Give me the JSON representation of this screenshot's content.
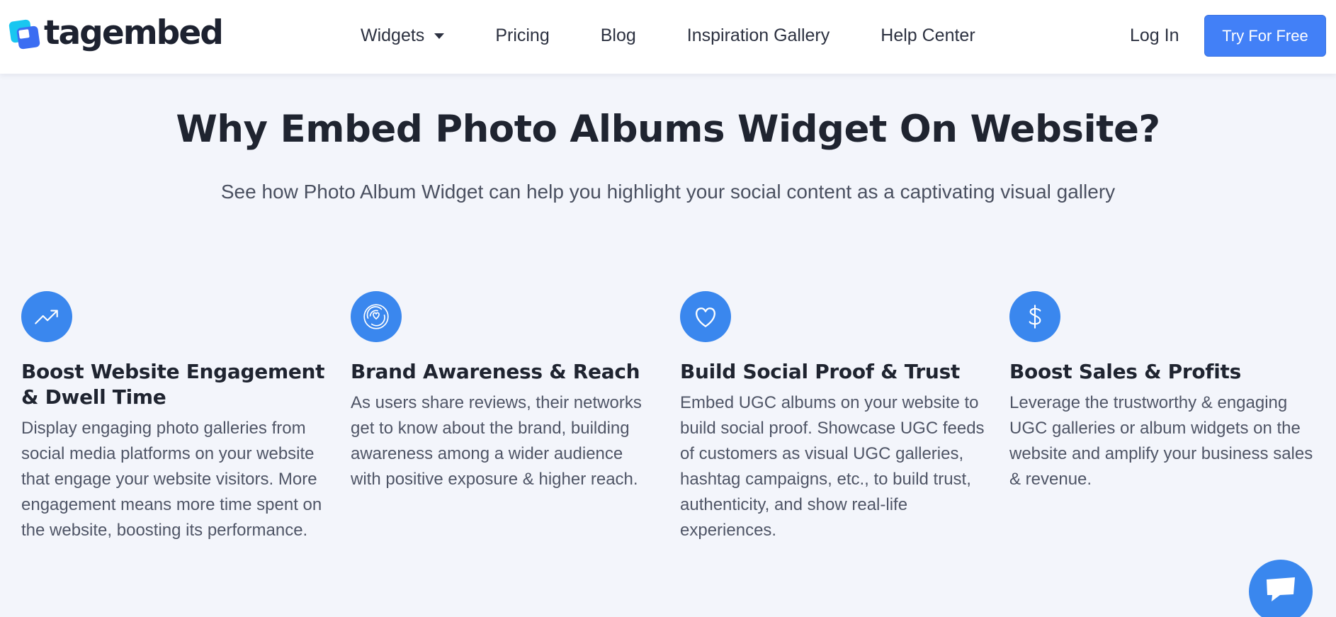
{
  "brand": {
    "name": "tagembed"
  },
  "nav": {
    "items": [
      {
        "label": "Widgets",
        "has_dropdown": true
      },
      {
        "label": "Pricing"
      },
      {
        "label": "Blog"
      },
      {
        "label": "Inspiration Gallery"
      },
      {
        "label": "Help Center"
      }
    ],
    "login_label": "Log In",
    "cta_label": "Try For Free"
  },
  "hero": {
    "title": "Why Embed Photo Albums Widget On Website?",
    "subtitle": "See how Photo Album Widget can help you highlight your social content as a captivating visual gallery"
  },
  "features": [
    {
      "icon": "trending-up-icon",
      "title": "Boost Website Engagement & Dwell Time",
      "text": "Display engaging photo galleries from social media platforms on your website that engage your website visitors. More engagement means more time spent on the website, boosting its performance."
    },
    {
      "icon": "heart-target-icon",
      "title": "Brand Awareness & Reach",
      "text": "As users share reviews, their networks get to know about the brand, building awareness among a wider audience with positive exposure & higher reach."
    },
    {
      "icon": "heart-icon",
      "title": "Build Social Proof & Trust",
      "text": "Embed UGC albums on your website to build social proof. Showcase UGC feeds of customers as visual UGC galleries, hashtag campaigns, etc., to build trust, authenticity, and show real-life experiences."
    },
    {
      "icon": "dollar-icon",
      "title": "Boost Sales & Profits",
      "text": "Leverage the trustworthy & engaging UGC galleries or album widgets on the website and amplify your business sales & revenue."
    }
  ],
  "chat": {
    "icon": "chat-bubble-icon"
  },
  "colors": {
    "accent": "#4280f7",
    "icon_circle": "#3a87ee",
    "page_bg": "#f3f5fb",
    "heading": "#1f2430",
    "body_text": "#4f5566",
    "logo_cyan": "#19c6f0",
    "logo_blue": "#3b6df2"
  }
}
